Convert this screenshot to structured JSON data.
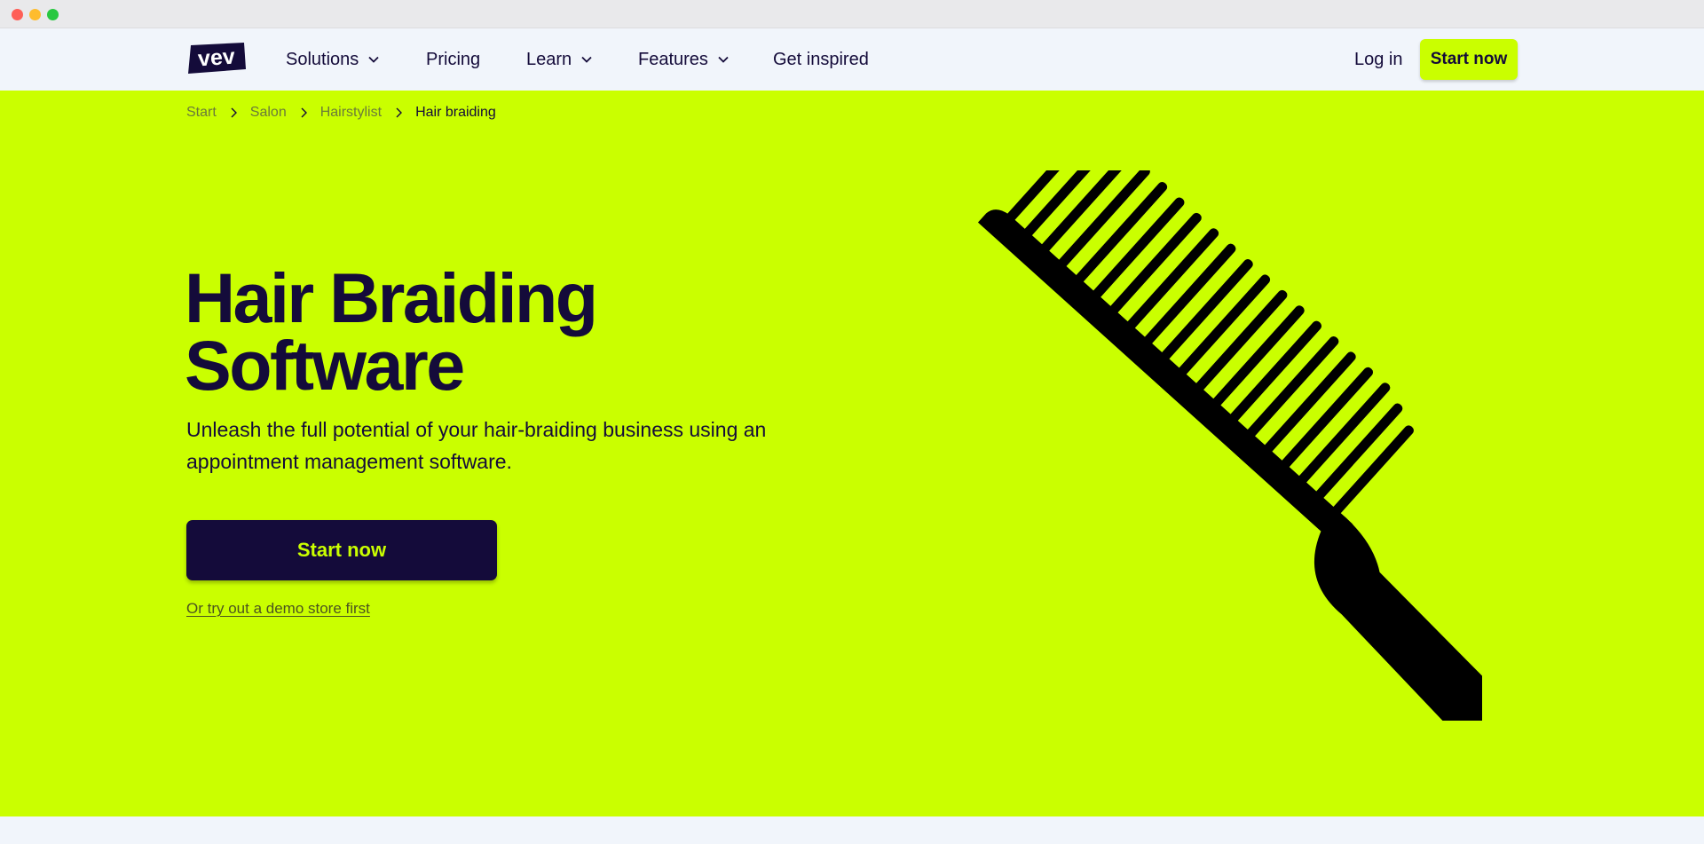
{
  "nav": {
    "logo_text": "vev",
    "items": [
      {
        "label": "Solutions",
        "has_dropdown": true
      },
      {
        "label": "Pricing",
        "has_dropdown": false
      },
      {
        "label": "Learn",
        "has_dropdown": true
      },
      {
        "label": "Features",
        "has_dropdown": true
      },
      {
        "label": "Get inspired",
        "has_dropdown": false
      }
    ],
    "login_label": "Log in",
    "cta_label": "Start now"
  },
  "breadcrumb": {
    "items": [
      "Start",
      "Salon",
      "Hairstylist"
    ],
    "current": "Hair braiding"
  },
  "hero": {
    "title_line1": "Hair Braiding",
    "title_line2": "Software",
    "subtitle": "Unleash the full potential of your hair-braiding business using an appointment management software.",
    "cta_label": "Start now",
    "demo_link": "Or try out a demo store first",
    "image_icon": "comb-icon"
  },
  "colors": {
    "accent": "#caff00",
    "brand_dark": "#140b3a",
    "page_bg": "#f1f5fb"
  }
}
